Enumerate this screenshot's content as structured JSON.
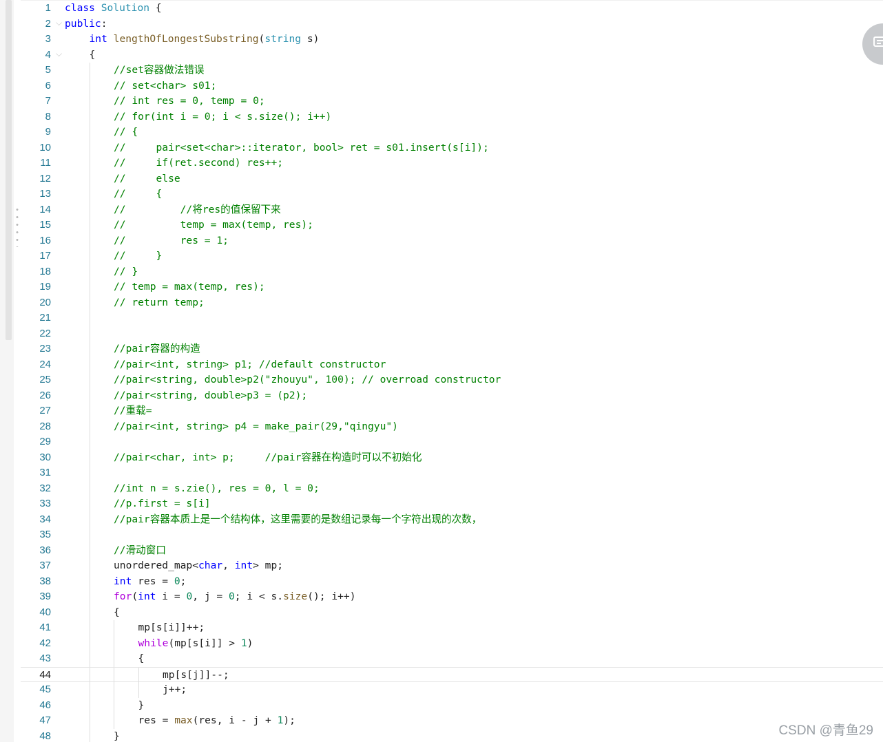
{
  "editor": {
    "current_line": 44,
    "lines": [
      {
        "n": "1",
        "indent": 0,
        "fold": false,
        "tokens": [
          {
            "t": "kw",
            "v": "class"
          },
          {
            "t": "txt",
            "v": " "
          },
          {
            "t": "type",
            "v": "Solution"
          },
          {
            "t": "txt",
            "v": " {"
          }
        ]
      },
      {
        "n": "2",
        "indent": 0,
        "fold": true,
        "tokens": [
          {
            "t": "kw",
            "v": "public"
          },
          {
            "t": "txt",
            "v": ":"
          }
        ]
      },
      {
        "n": "3",
        "indent": 1,
        "fold": false,
        "tokens": [
          {
            "t": "kw",
            "v": "int"
          },
          {
            "t": "txt",
            "v": " "
          },
          {
            "t": "fn",
            "v": "lengthOfLongestSubstring"
          },
          {
            "t": "txt",
            "v": "("
          },
          {
            "t": "type",
            "v": "string"
          },
          {
            "t": "txt",
            "v": " s)"
          }
        ]
      },
      {
        "n": "4",
        "indent": 1,
        "fold": true,
        "tokens": [
          {
            "t": "txt",
            "v": "{"
          }
        ]
      },
      {
        "n": "5",
        "indent": 2,
        "fold": false,
        "tokens": [
          {
            "t": "com",
            "v": "//set容器做法错误"
          }
        ]
      },
      {
        "n": "6",
        "indent": 2,
        "fold": false,
        "tokens": [
          {
            "t": "com",
            "v": "// set<char> s01;"
          }
        ]
      },
      {
        "n": "7",
        "indent": 2,
        "fold": false,
        "tokens": [
          {
            "t": "com",
            "v": "// int res = 0, temp = 0;"
          }
        ]
      },
      {
        "n": "8",
        "indent": 2,
        "fold": false,
        "tokens": [
          {
            "t": "com",
            "v": "// for(int i = 0; i < s.size(); i++)"
          }
        ]
      },
      {
        "n": "9",
        "indent": 2,
        "fold": false,
        "tokens": [
          {
            "t": "com",
            "v": "// {"
          }
        ]
      },
      {
        "n": "10",
        "indent": 2,
        "fold": false,
        "tokens": [
          {
            "t": "com",
            "v": "//     pair<set<char>::iterator, bool> ret = s01.insert(s[i]);"
          }
        ]
      },
      {
        "n": "11",
        "indent": 2,
        "fold": false,
        "tokens": [
          {
            "t": "com",
            "v": "//     if(ret.second) res++;"
          }
        ]
      },
      {
        "n": "12",
        "indent": 2,
        "fold": false,
        "tokens": [
          {
            "t": "com",
            "v": "//     else"
          }
        ]
      },
      {
        "n": "13",
        "indent": 2,
        "fold": false,
        "tokens": [
          {
            "t": "com",
            "v": "//     {"
          }
        ]
      },
      {
        "n": "14",
        "indent": 2,
        "fold": false,
        "tokens": [
          {
            "t": "com",
            "v": "//         //将res的值保留下来"
          }
        ]
      },
      {
        "n": "15",
        "indent": 2,
        "fold": false,
        "tokens": [
          {
            "t": "com",
            "v": "//         temp = max(temp, res);"
          }
        ]
      },
      {
        "n": "16",
        "indent": 2,
        "fold": false,
        "tokens": [
          {
            "t": "com",
            "v": "//         res = 1;"
          }
        ]
      },
      {
        "n": "17",
        "indent": 2,
        "fold": false,
        "tokens": [
          {
            "t": "com",
            "v": "//     }"
          }
        ]
      },
      {
        "n": "18",
        "indent": 2,
        "fold": false,
        "tokens": [
          {
            "t": "com",
            "v": "// }"
          }
        ]
      },
      {
        "n": "19",
        "indent": 2,
        "fold": false,
        "tokens": [
          {
            "t": "com",
            "v": "// temp = max(temp, res);"
          }
        ]
      },
      {
        "n": "20",
        "indent": 2,
        "fold": false,
        "tokens": [
          {
            "t": "com",
            "v": "// return temp;"
          }
        ]
      },
      {
        "n": "21",
        "indent": 2,
        "fold": false,
        "tokens": []
      },
      {
        "n": "22",
        "indent": 2,
        "fold": false,
        "tokens": []
      },
      {
        "n": "23",
        "indent": 2,
        "fold": false,
        "tokens": [
          {
            "t": "com",
            "v": "//pair容器的构造"
          }
        ]
      },
      {
        "n": "24",
        "indent": 2,
        "fold": false,
        "tokens": [
          {
            "t": "com",
            "v": "//pair<int, string> p1; //default constructor"
          }
        ]
      },
      {
        "n": "25",
        "indent": 2,
        "fold": false,
        "tokens": [
          {
            "t": "com",
            "v": "//pair<string, double>p2(\"zhouyu\", 100); // overroad constructor"
          }
        ]
      },
      {
        "n": "26",
        "indent": 2,
        "fold": false,
        "tokens": [
          {
            "t": "com",
            "v": "//pair<string, double>p3 = (p2);"
          }
        ]
      },
      {
        "n": "27",
        "indent": 2,
        "fold": false,
        "tokens": [
          {
            "t": "com",
            "v": "//重载="
          }
        ]
      },
      {
        "n": "28",
        "indent": 2,
        "fold": false,
        "tokens": [
          {
            "t": "com",
            "v": "//pair<int, string> p4 = make_pair(29,\"qingyu\")"
          }
        ]
      },
      {
        "n": "29",
        "indent": 2,
        "fold": false,
        "tokens": []
      },
      {
        "n": "30",
        "indent": 2,
        "fold": false,
        "tokens": [
          {
            "t": "com",
            "v": "//pair<char, int> p;     //pair容器在构造时可以不初始化"
          }
        ]
      },
      {
        "n": "31",
        "indent": 2,
        "fold": false,
        "tokens": []
      },
      {
        "n": "32",
        "indent": 2,
        "fold": false,
        "tokens": [
          {
            "t": "com",
            "v": "//int n = s.zie(), res = 0, l = 0;"
          }
        ]
      },
      {
        "n": "33",
        "indent": 2,
        "fold": false,
        "tokens": [
          {
            "t": "com",
            "v": "//p.first = s[i]"
          }
        ]
      },
      {
        "n": "34",
        "indent": 2,
        "fold": false,
        "tokens": [
          {
            "t": "com",
            "v": "//pair容器本质上是一个结构体，这里需要的是数组记录每一个字符出现的次数，"
          }
        ]
      },
      {
        "n": "35",
        "indent": 2,
        "fold": false,
        "tokens": []
      },
      {
        "n": "36",
        "indent": 2,
        "fold": false,
        "tokens": [
          {
            "t": "com",
            "v": "//滑动窗口"
          }
        ]
      },
      {
        "n": "37",
        "indent": 2,
        "fold": false,
        "tokens": [
          {
            "t": "txt",
            "v": "unordered_map<"
          },
          {
            "t": "kw",
            "v": "char"
          },
          {
            "t": "txt",
            "v": ", "
          },
          {
            "t": "kw",
            "v": "int"
          },
          {
            "t": "txt",
            "v": "> mp;"
          }
        ]
      },
      {
        "n": "38",
        "indent": 2,
        "fold": false,
        "tokens": [
          {
            "t": "kw",
            "v": "int"
          },
          {
            "t": "txt",
            "v": " res = "
          },
          {
            "t": "num",
            "v": "0"
          },
          {
            "t": "txt",
            "v": ";"
          }
        ]
      },
      {
        "n": "39",
        "indent": 2,
        "fold": false,
        "tokens": [
          {
            "t": "ctl",
            "v": "for"
          },
          {
            "t": "txt",
            "v": "("
          },
          {
            "t": "kw",
            "v": "int"
          },
          {
            "t": "txt",
            "v": " i = "
          },
          {
            "t": "num",
            "v": "0"
          },
          {
            "t": "txt",
            "v": ", j = "
          },
          {
            "t": "num",
            "v": "0"
          },
          {
            "t": "txt",
            "v": "; i < s."
          },
          {
            "t": "fn",
            "v": "size"
          },
          {
            "t": "txt",
            "v": "(); i++)"
          }
        ]
      },
      {
        "n": "40",
        "indent": 2,
        "fold": false,
        "tokens": [
          {
            "t": "txt",
            "v": "{"
          }
        ]
      },
      {
        "n": "41",
        "indent": 3,
        "fold": false,
        "tokens": [
          {
            "t": "txt",
            "v": "mp[s[i]]++;"
          }
        ]
      },
      {
        "n": "42",
        "indent": 3,
        "fold": false,
        "tokens": [
          {
            "t": "ctl",
            "v": "while"
          },
          {
            "t": "txt",
            "v": "(mp[s[i]] > "
          },
          {
            "t": "num",
            "v": "1"
          },
          {
            "t": "txt",
            "v": ")"
          }
        ]
      },
      {
        "n": "43",
        "indent": 3,
        "fold": false,
        "tokens": [
          {
            "t": "txt",
            "v": "{"
          }
        ]
      },
      {
        "n": "44",
        "indent": 4,
        "fold": false,
        "tokens": [
          {
            "t": "txt",
            "v": "mp[s[j]]--;"
          }
        ]
      },
      {
        "n": "45",
        "indent": 4,
        "fold": false,
        "tokens": [
          {
            "t": "txt",
            "v": "j++;"
          }
        ]
      },
      {
        "n": "46",
        "indent": 3,
        "fold": false,
        "tokens": [
          {
            "t": "txt",
            "v": "}"
          }
        ]
      },
      {
        "n": "47",
        "indent": 3,
        "fold": false,
        "tokens": [
          {
            "t": "txt",
            "v": "res = "
          },
          {
            "t": "fn",
            "v": "max"
          },
          {
            "t": "txt",
            "v": "(res, i - j + "
          },
          {
            "t": "num",
            "v": "1"
          },
          {
            "t": "txt",
            "v": ");"
          }
        ]
      },
      {
        "n": "48",
        "indent": 2,
        "fold": false,
        "tokens": [
          {
            "t": "txt",
            "v": "}"
          }
        ]
      }
    ]
  },
  "side_button": {
    "icon": "comment-icon"
  },
  "watermark": {
    "text": "CSDN @青鱼29"
  },
  "colors": {
    "keyword": "#0000ff",
    "type": "#2b91af",
    "number": "#098658",
    "comment": "#008000",
    "function": "#795e26",
    "control": "#af00db",
    "line_number": "#237893"
  }
}
